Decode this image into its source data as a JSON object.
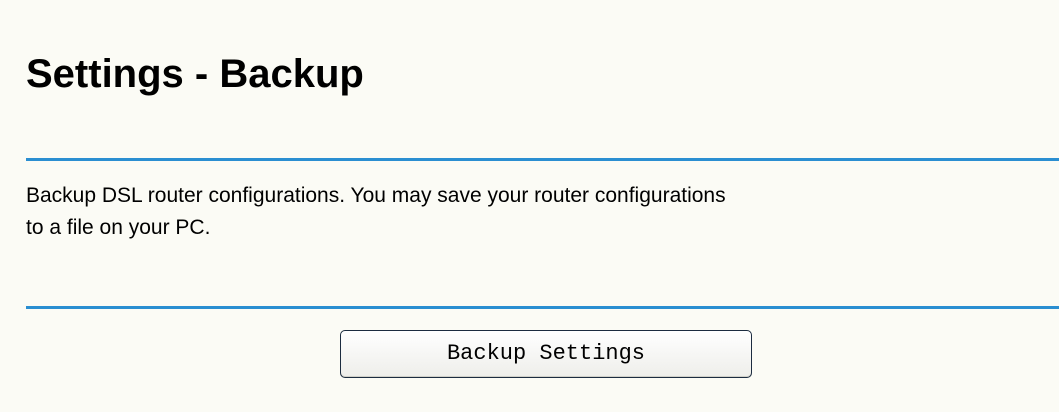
{
  "page": {
    "title": "Settings - Backup",
    "description_line1": "Backup DSL router configurations. You may save your router configurations",
    "description_line2": "to a file on your PC.",
    "backup_button_label": "Backup Settings"
  },
  "colors": {
    "background": "#fbfbf5",
    "divider": "#2a8ed1",
    "text": "#000000"
  }
}
